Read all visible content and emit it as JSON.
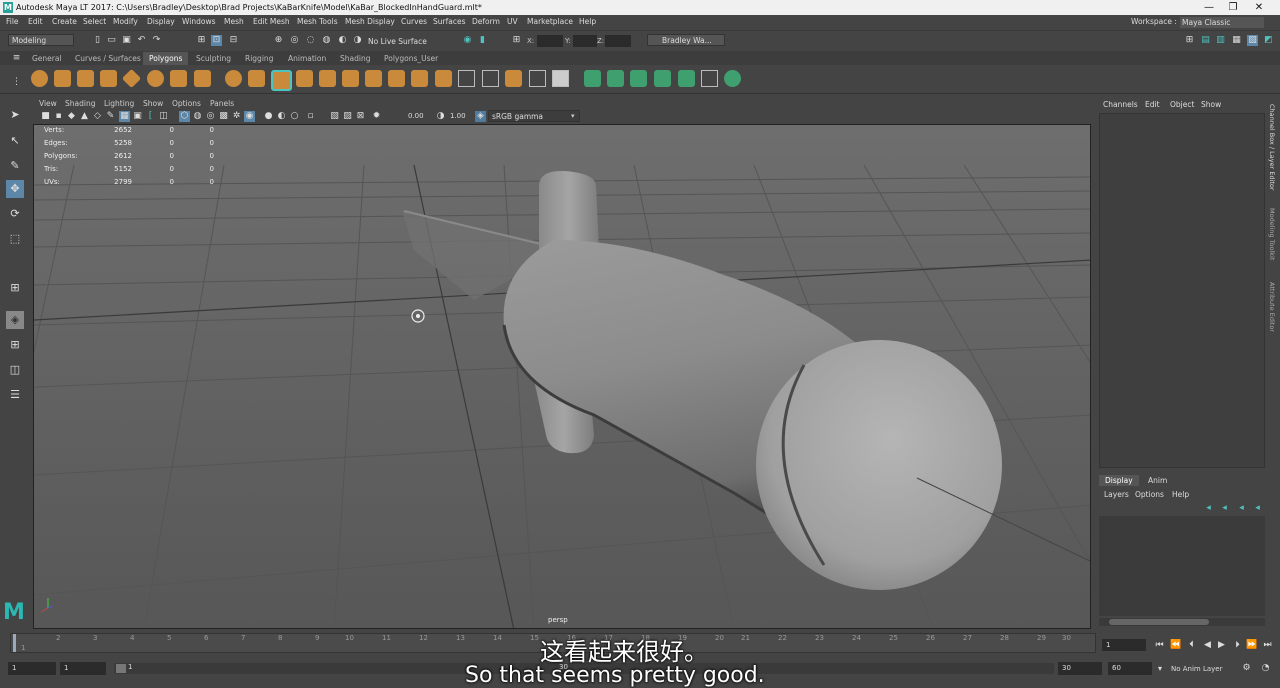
{
  "titlebar": {
    "title": "Autodesk Maya LT 2017: C:\\Users\\Bradley\\Desktop\\Brad Projects\\KaBarKnife\\Model\\KaBar_BlockedInHandGuard.mlt*",
    "minimize": "—",
    "maximize": "❐",
    "close": "✕"
  },
  "menubar": {
    "items": [
      "File",
      "Edit",
      "Create",
      "Select",
      "Modify",
      "Display",
      "Windows",
      "Mesh",
      "Edit Mesh",
      "Mesh Tools",
      "Mesh Display",
      "Curves",
      "Surfaces",
      "Deform",
      "UV",
      "Marketplace",
      "Help"
    ],
    "workspace_label": "Workspace :",
    "workspace_value": "Maya Classic"
  },
  "statusline": {
    "mode": "Modeling",
    "live_surface": "No Live Surface",
    "x_label": "X:",
    "y_label": "Y:",
    "z_label": "Z:",
    "user": "Bradley Wa..."
  },
  "shelf_tabs": [
    "General",
    "Curves / Surfaces",
    "Polygons",
    "Sculpting",
    "Rigging",
    "Animation",
    "Shading",
    "Polygons_User"
  ],
  "shelf_active": "Polygons",
  "panel_menu": [
    "View",
    "Shading",
    "Lighting",
    "Show",
    "Options",
    "Panels"
  ],
  "panel_toolbar": {
    "exposure": "0.00",
    "gamma": "1.00",
    "color_space": "sRGB gamma"
  },
  "hud": [
    {
      "label": "Verts:",
      "v1": "2652",
      "v2": "0",
      "v3": "0"
    },
    {
      "label": "Edges:",
      "v1": "5258",
      "v2": "0",
      "v3": "0"
    },
    {
      "label": "Polygons:",
      "v1": "2612",
      "v2": "0",
      "v3": "0"
    },
    {
      "label": "Tris:",
      "v1": "5152",
      "v2": "0",
      "v3": "0"
    },
    {
      "label": "UVs:",
      "v1": "2799",
      "v2": "0",
      "v3": "0"
    }
  ],
  "camera_label": "persp",
  "channelbox": {
    "menu": [
      "Channels",
      "Edit",
      "Object",
      "Show"
    ]
  },
  "side_tabs": [
    "Channel Box / Layer Editor",
    "Modeling Toolkit",
    "Attribute Editor"
  ],
  "layer_editor": {
    "tabs": [
      "Display",
      "Anim"
    ],
    "menu": [
      "Layers",
      "Options",
      "Help"
    ]
  },
  "timeline": {
    "ticks": [
      "1",
      "2",
      "3",
      "4",
      "5",
      "6",
      "7",
      "8",
      "9",
      "10",
      "11",
      "12",
      "13",
      "14",
      "15",
      "16",
      "17",
      "18",
      "19",
      "20",
      "21",
      "22",
      "23",
      "24",
      "25",
      "26",
      "27",
      "28",
      "29",
      "30"
    ],
    "current_frame": "1"
  },
  "range": {
    "start": "1",
    "playback_start": "1",
    "slider_label": "1",
    "slider_end": "30",
    "playback_end": "30",
    "end": "60",
    "anim_layer": "No Anim Layer"
  },
  "subtitles": {
    "cn": "这看起来很好。",
    "en": "So that seems pretty good."
  }
}
